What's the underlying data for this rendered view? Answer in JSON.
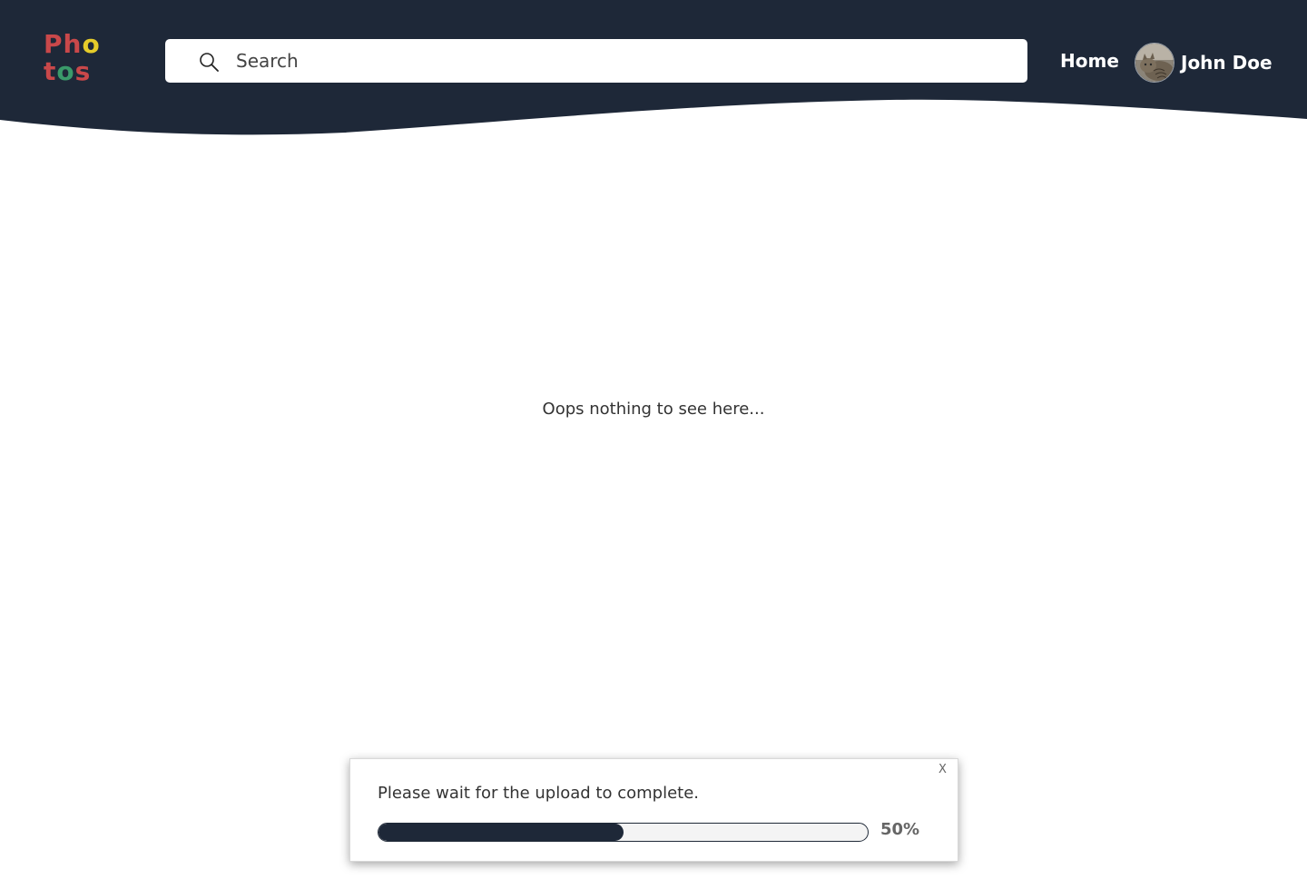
{
  "colors": {
    "header_bg": "#1e2838",
    "logo_letters": [
      "#c9484a",
      "#c9484a",
      "#e5cc2a",
      "#c9484a",
      "#3a9a6a",
      "#c9484a"
    ],
    "progress_fill": "#1e2838"
  },
  "logo": {
    "letters_row1": [
      "P",
      "h",
      "o"
    ],
    "letters_row2": [
      "t",
      "o",
      "s"
    ]
  },
  "search": {
    "placeholder": "Search",
    "icon": "search-icon"
  },
  "nav": {
    "home_label": "Home"
  },
  "user": {
    "name": "John Doe",
    "avatar": "cat-avatar"
  },
  "main": {
    "empty_message": "Oops nothing to see here..."
  },
  "upload_toast": {
    "close_label": "X",
    "message": "Please wait for the upload to complete.",
    "progress_percent": 50,
    "progress_label": "50%"
  }
}
